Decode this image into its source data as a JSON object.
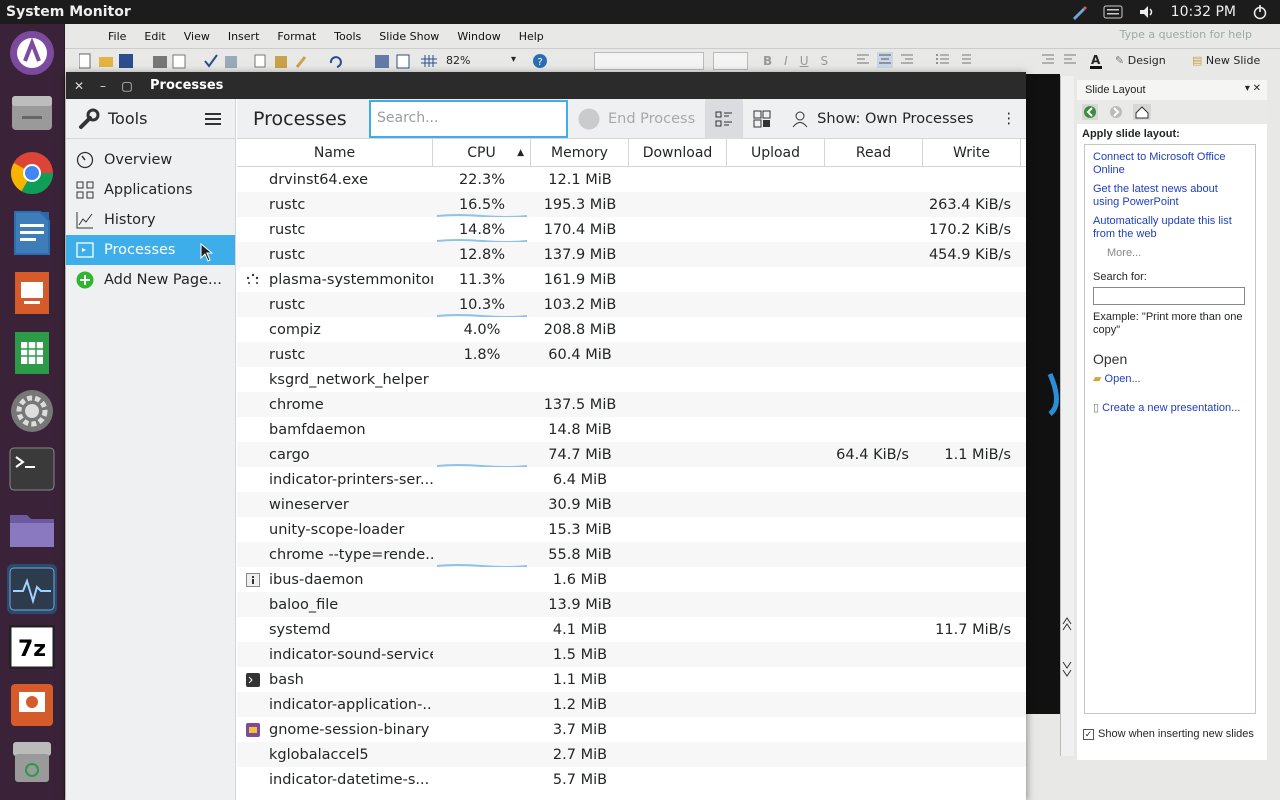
{
  "topbar": {
    "app_title": "System Monitor",
    "clock": "10:32 PM"
  },
  "office": {
    "menu": [
      "File",
      "Edit",
      "View",
      "Insert",
      "Format",
      "Tools",
      "Slide Show",
      "Window",
      "Help"
    ],
    "help_placeholder": "Type a question for help",
    "zoom": "82%",
    "design_label": "Design",
    "new_slide_label": "New Slide",
    "taskpane": {
      "title": "Slide Layout",
      "subtitle": "Apply slide layout:",
      "links": [
        "Connect to Microsoft Office Online",
        "Get the latest news about using PowerPoint",
        "Automatically update this list from the web"
      ],
      "more": "More...",
      "search_label": "Search for:",
      "example_label": "Example:",
      "example_text": "\"Print more than one copy\"",
      "open_heading": "Open",
      "open_link": "Open...",
      "create_link": "Create a new presentation...",
      "show_check": "Show when inserting new slides"
    }
  },
  "window": {
    "title": "Processes"
  },
  "sidebar": {
    "title": "Tools",
    "items": [
      {
        "label": "Overview",
        "icon": "gauge-icon"
      },
      {
        "label": "Applications",
        "icon": "grid-icon"
      },
      {
        "label": "History",
        "icon": "chart-line-icon"
      },
      {
        "label": "Processes",
        "icon": "process-icon",
        "active": true
      },
      {
        "label": "Add New Page...",
        "icon": "plus-circle-icon"
      }
    ]
  },
  "main": {
    "title": "Processes",
    "search_placeholder": "Search...",
    "end_process": "End Process",
    "show_filter": "Show: Own Processes"
  },
  "columns": [
    "Name",
    "CPU",
    "Memory",
    "Download",
    "Upload",
    "Read",
    "Write"
  ],
  "processes": [
    {
      "icon": "",
      "name": "drvinst64.exe",
      "cpu": "22.3%",
      "mem": "12.1 MiB",
      "read": "",
      "write": ""
    },
    {
      "icon": "",
      "name": "rustc",
      "cpu": "16.5%",
      "mem": "195.3 MiB",
      "read": "",
      "write": "263.4 KiB/s"
    },
    {
      "icon": "",
      "name": "rustc",
      "cpu": "14.8%",
      "mem": "170.4 MiB",
      "read": "",
      "write": "170.2 KiB/s"
    },
    {
      "icon": "",
      "name": "rustc",
      "cpu": "12.8%",
      "mem": "137.9 MiB",
      "read": "",
      "write": "454.9 KiB/s"
    },
    {
      "icon": "spinner-icon",
      "name": "plasma-systemmonitor",
      "cpu": "11.3%",
      "mem": "161.9 MiB",
      "read": "",
      "write": ""
    },
    {
      "icon": "",
      "name": "rustc",
      "cpu": "10.3%",
      "mem": "103.2 MiB",
      "read": "",
      "write": ""
    },
    {
      "icon": "",
      "name": "compiz",
      "cpu": "4.0%",
      "mem": "208.8 MiB",
      "read": "",
      "write": ""
    },
    {
      "icon": "",
      "name": "rustc",
      "cpu": "1.8%",
      "mem": "60.4 MiB",
      "read": "",
      "write": ""
    },
    {
      "icon": "",
      "name": "ksgrd_network_helper",
      "cpu": "",
      "mem": "",
      "read": "",
      "write": ""
    },
    {
      "icon": "",
      "name": "chrome",
      "cpu": "",
      "mem": "137.5 MiB",
      "read": "",
      "write": ""
    },
    {
      "icon": "",
      "name": "bamfdaemon",
      "cpu": "",
      "mem": "14.8 MiB",
      "read": "",
      "write": ""
    },
    {
      "icon": "",
      "name": "cargo",
      "cpu": "",
      "mem": "74.7 MiB",
      "read": "64.4 KiB/s",
      "write": "1.1 MiB/s"
    },
    {
      "icon": "",
      "name": "indicator-printers-ser...",
      "cpu": "",
      "mem": "6.4 MiB",
      "read": "",
      "write": ""
    },
    {
      "icon": "",
      "name": "wineserver",
      "cpu": "",
      "mem": "30.9 MiB",
      "read": "",
      "write": ""
    },
    {
      "icon": "",
      "name": "unity-scope-loader",
      "cpu": "",
      "mem": "15.3 MiB",
      "read": "",
      "write": ""
    },
    {
      "icon": "",
      "name": "chrome --type=rende...",
      "cpu": "",
      "mem": "55.8 MiB",
      "read": "",
      "write": ""
    },
    {
      "icon": "info-icon",
      "name": "ibus-daemon",
      "cpu": "",
      "mem": "1.6 MiB",
      "read": "",
      "write": ""
    },
    {
      "icon": "",
      "name": "baloo_file",
      "cpu": "",
      "mem": "13.9 MiB",
      "read": "",
      "write": ""
    },
    {
      "icon": "",
      "name": "systemd",
      "cpu": "",
      "mem": "4.1 MiB",
      "read": "",
      "write": "11.7 MiB/s"
    },
    {
      "icon": "",
      "name": "indicator-sound-service",
      "cpu": "",
      "mem": "1.5 MiB",
      "read": "",
      "write": ""
    },
    {
      "icon": "terminal-icon",
      "name": "bash",
      "cpu": "",
      "mem": "1.1 MiB",
      "read": "",
      "write": ""
    },
    {
      "icon": "",
      "name": "indicator-application-...",
      "cpu": "",
      "mem": "1.2 MiB",
      "read": "",
      "write": ""
    },
    {
      "icon": "session-icon",
      "name": "gnome-session-binary",
      "cpu": "",
      "mem": "3.7 MiB",
      "read": "",
      "write": ""
    },
    {
      "icon": "",
      "name": "kglobalaccel5",
      "cpu": "",
      "mem": "2.7 MiB",
      "read": "",
      "write": ""
    },
    {
      "icon": "",
      "name": "indicator-datetime-s...",
      "cpu": "",
      "mem": "5.7 MiB",
      "read": "",
      "write": ""
    }
  ],
  "colors": {
    "accent": "#3daee9",
    "launcher_bg": "#3a2338"
  }
}
